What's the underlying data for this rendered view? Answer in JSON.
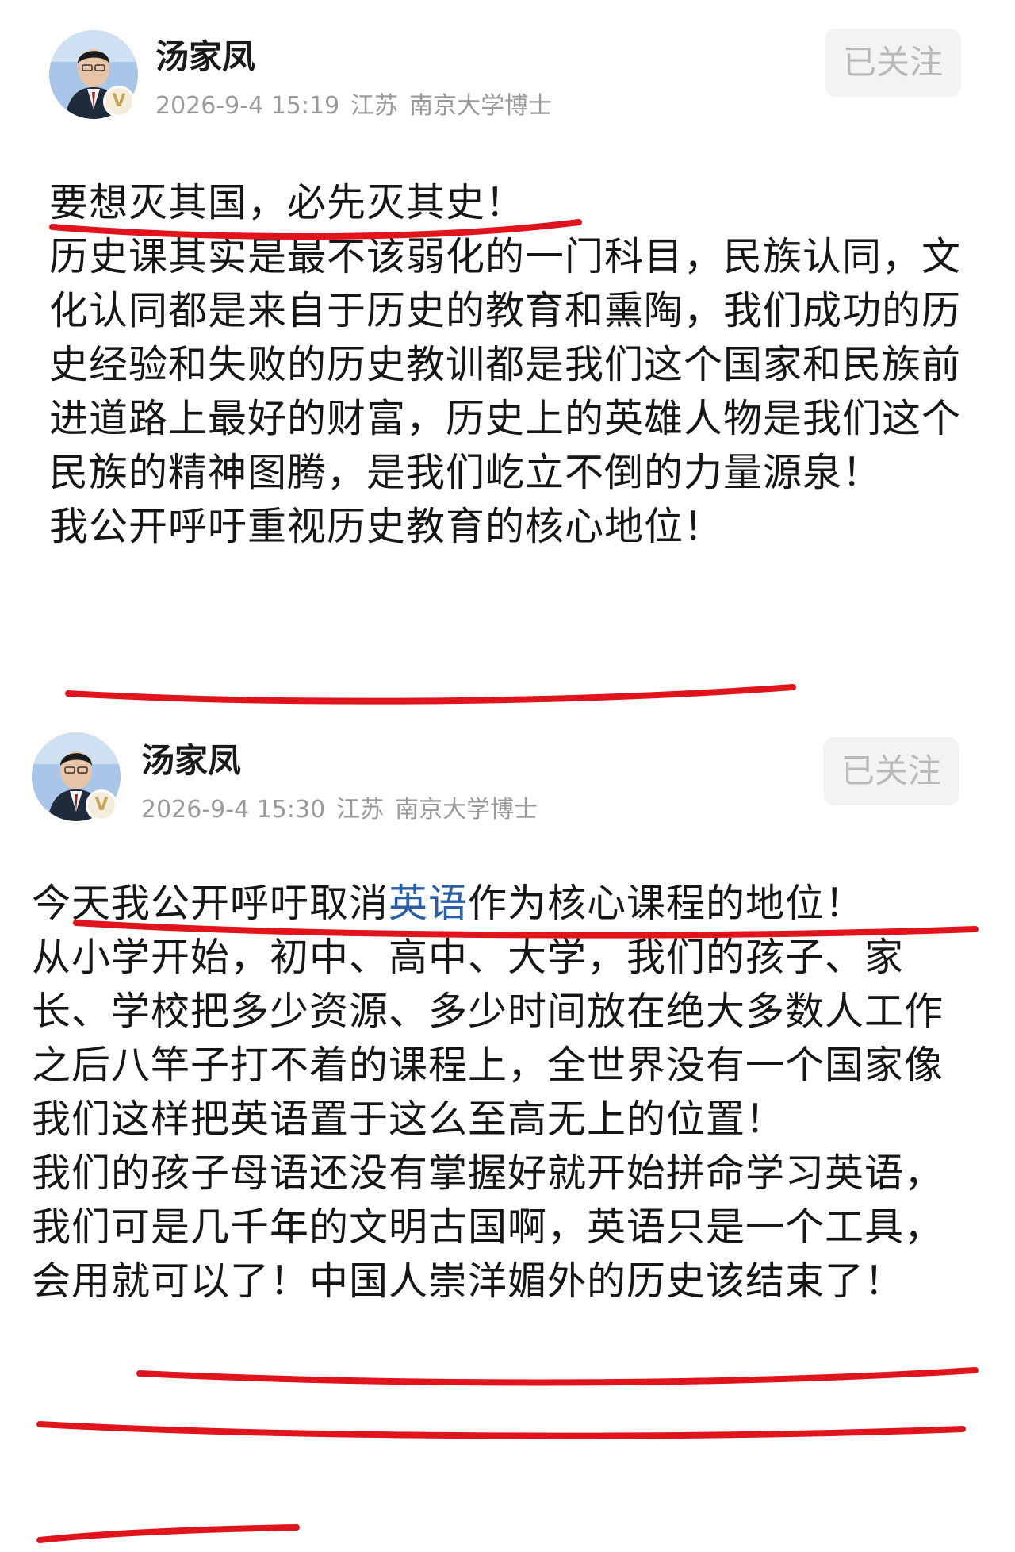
{
  "posts": [
    {
      "author": "汤家凤",
      "date_time": "2026-9-4 15:19",
      "region": "江苏",
      "title": "南京大学博士",
      "verified_badge": "V",
      "follow_label": "已关注",
      "paragraphs": [
        "要想灭其国，必先灭其史！",
        "历史课其实是最不该弱化的一门科目，民族认同，文化认同都是来自于历史的教育和熏陶，我们成功的历史经验和失败的历史教训都是我们这个国家和民族前进道路上最好的财富，历史上的英雄人物是我们这个民族的精神图腾，是我们屹立不倒的力量源泉！",
        "我公开呼吁重视历史教育的核心地位！"
      ]
    },
    {
      "author": "汤家凤",
      "date_time": "2026-9-4 15:30",
      "region": "江苏",
      "title": "南京大学博士",
      "verified_badge": "V",
      "follow_label": "已关注",
      "headline_before": "今天我公开呼吁取消",
      "headline_link": "英语",
      "headline_after": "作为核心课程的地位！",
      "paragraphs": [
        "从小学开始，初中、高中、大学，我们的孩子、家长、学校把多少资源、多少时间放在绝大多数人工作之后八竿子打不着的课程上，全世界没有一个国家像我们这样把英语置于这么至高无上的位置！",
        "我们的孩子母语还没有掌握好就开始拼命学习英语，我们可是几千年的文明古国啊，英语只是一个工具，会用就可以了！中国人崇洋媚外的历史该结束了！"
      ]
    }
  ],
  "colors": {
    "underline": "#e0141c",
    "link_blue": "#2a5fa8",
    "meta_gray": "#9a9a9a",
    "follow_bg": "#f3f3f3"
  }
}
